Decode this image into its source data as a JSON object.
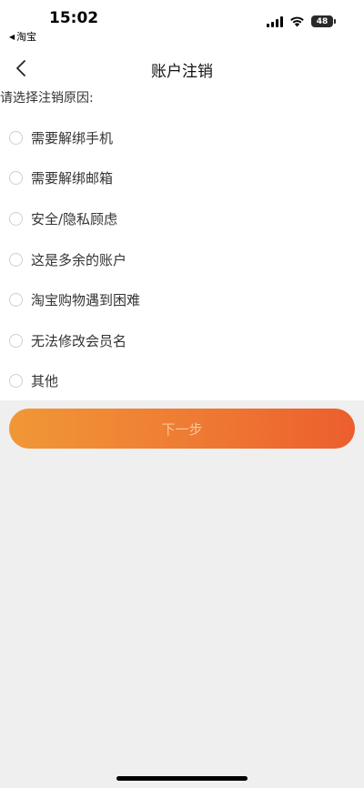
{
  "status_bar": {
    "time": "15:02",
    "back_app": "淘宝",
    "battery": "48"
  },
  "nav": {
    "title": "账户注销"
  },
  "form": {
    "prompt": "请选择注销原因:",
    "options": [
      {
        "label": "需要解绑手机"
      },
      {
        "label": "需要解绑邮箱"
      },
      {
        "label": "安全/隐私顾虑"
      },
      {
        "label": "这是多余的账户"
      },
      {
        "label": "淘宝购物遇到困难"
      },
      {
        "label": "无法修改会员名"
      },
      {
        "label": "其他"
      }
    ],
    "next_label": "下一步"
  },
  "icons": {
    "back": "chevron-left-icon",
    "signal": "cellular-signal-icon",
    "wifi": "wifi-icon",
    "battery": "battery-icon"
  },
  "colors": {
    "button_start": "#f19737",
    "button_end": "#ec5e2d",
    "button_text_disabled": "#f8c89a",
    "page_background": "#efefef"
  }
}
